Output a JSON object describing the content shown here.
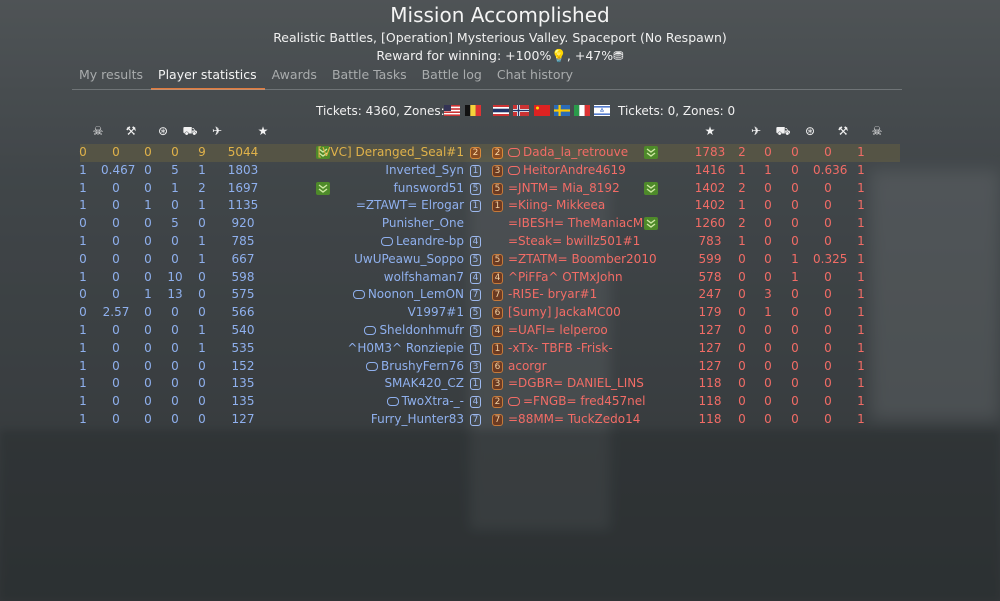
{
  "header": {
    "title": "Mission Accomplished",
    "subtitle": "Realistic Battles, [Operation] Mysterious Valley. Spaceport (No Respawn)",
    "reward": "Reward for winning: +100%💡, +47%⛃"
  },
  "tabs": [
    {
      "label": "My results",
      "active": false
    },
    {
      "label": "Player statistics",
      "active": true
    },
    {
      "label": "Awards",
      "active": false
    },
    {
      "label": "Battle Tasks",
      "active": false
    },
    {
      "label": "Battle log",
      "active": false
    },
    {
      "label": "Chat history",
      "active": false
    }
  ],
  "tickets": {
    "left": "Tickets: 4360, Zones: 0",
    "right": "Tickets: 0, Zones: 0",
    "left_flags": [
      "usa",
      "belgium"
    ],
    "right_flags": [
      "thailand",
      "norway",
      "china",
      "sweden",
      "italy",
      "israel"
    ]
  },
  "column_icons": [
    "deaths-icon",
    "assists-icon",
    "captures-icon",
    "ground-kills-icon",
    "air-kills-icon",
    "score-star-icon"
  ],
  "colors": {
    "ally": "#8fb0ee",
    "enemy": "#f26c66",
    "self": "#e0b24a",
    "accent": "#e07b3e"
  },
  "left_team": [
    {
      "deaths": "0",
      "assists": "0",
      "captures": "0",
      "ground": "0",
      "air": "9",
      "score": "5044",
      "name": "[VVC] Deranged_Seal#1",
      "rank": "2",
      "self": true,
      "chevron": true
    },
    {
      "deaths": "1",
      "assists": "0.467",
      "captures": "0",
      "ground": "5",
      "air": "1",
      "score": "1803",
      "name": "Inverted_Syn",
      "rank": "1"
    },
    {
      "deaths": "1",
      "assists": "0",
      "captures": "0",
      "ground": "1",
      "air": "2",
      "score": "1697",
      "name": "funsword51",
      "rank": "5",
      "chevron": true
    },
    {
      "deaths": "1",
      "assists": "0",
      "captures": "1",
      "ground": "0",
      "air": "1",
      "score": "1135",
      "name": "=ZTAWT= Elrogar",
      "rank": "1"
    },
    {
      "deaths": "0",
      "assists": "0",
      "captures": "0",
      "ground": "5",
      "air": "0",
      "score": "920",
      "name": "Punisher_One",
      "rank": ""
    },
    {
      "deaths": "1",
      "assists": "0",
      "captures": "0",
      "ground": "0",
      "air": "1",
      "score": "785",
      "name": "Leandre-bp",
      "rank": "4",
      "pad": true
    },
    {
      "deaths": "0",
      "assists": "0",
      "captures": "0",
      "ground": "0",
      "air": "1",
      "score": "667",
      "name": "UwUPeawu_Soppo",
      "rank": "5"
    },
    {
      "deaths": "1",
      "assists": "0",
      "captures": "0",
      "ground": "10",
      "air": "0",
      "score": "598",
      "name": "wolfshaman7",
      "rank": "4"
    },
    {
      "deaths": "0",
      "assists": "0",
      "captures": "1",
      "ground": "13",
      "air": "0",
      "score": "575",
      "name": "Noonon_LemON",
      "rank": "7",
      "pad": true
    },
    {
      "deaths": "0",
      "assists": "2.57",
      "captures": "0",
      "ground": "0",
      "air": "0",
      "score": "566",
      "name": "V1997#1",
      "rank": "5"
    },
    {
      "deaths": "1",
      "assists": "0",
      "captures": "0",
      "ground": "0",
      "air": "1",
      "score": "540",
      "name": "Sheldonhmufr",
      "rank": "5",
      "pad": true
    },
    {
      "deaths": "1",
      "assists": "0",
      "captures": "0",
      "ground": "0",
      "air": "1",
      "score": "535",
      "name": "^H0M3^ Ronziepie",
      "rank": "1"
    },
    {
      "deaths": "1",
      "assists": "0",
      "captures": "0",
      "ground": "0",
      "air": "0",
      "score": "152",
      "name": "BrushyFern76",
      "rank": "3",
      "pad": true
    },
    {
      "deaths": "1",
      "assists": "0",
      "captures": "0",
      "ground": "0",
      "air": "0",
      "score": "135",
      "name": "SMAK420_CZ",
      "rank": "1"
    },
    {
      "deaths": "1",
      "assists": "0",
      "captures": "0",
      "ground": "0",
      "air": "0",
      "score": "135",
      "name": "TwoXtra-_-",
      "rank": "4",
      "pad": true
    },
    {
      "deaths": "1",
      "assists": "0",
      "captures": "0",
      "ground": "0",
      "air": "0",
      "score": "127",
      "name": "Furry_Hunter83",
      "rank": "7"
    }
  ],
  "right_team": [
    {
      "rank": "2",
      "name": "Dada_la_retrouve",
      "pad": true,
      "chevron": true,
      "score": "1783",
      "air": "2",
      "ground": "0",
      "captures": "0",
      "assists": "0",
      "deaths": "1"
    },
    {
      "rank": "3",
      "name": "HeitorAndre4619",
      "pad": true,
      "score": "1416",
      "air": "1",
      "ground": "1",
      "captures": "0",
      "assists": "0.636",
      "deaths": "1"
    },
    {
      "rank": "5",
      "name": "=JNTM= Mia_8192",
      "chevron": true,
      "score": "1402",
      "air": "2",
      "ground": "0",
      "captures": "0",
      "assists": "0",
      "deaths": "1"
    },
    {
      "rank": "1",
      "name": "=Kiing- Mikkeea",
      "score": "1402",
      "air": "1",
      "ground": "0",
      "captures": "0",
      "assists": "0",
      "deaths": "1"
    },
    {
      "rank": "",
      "name": "=IBESH= TheManiacMan",
      "chevron": true,
      "score": "1260",
      "air": "2",
      "ground": "0",
      "captures": "0",
      "assists": "0",
      "deaths": "1"
    },
    {
      "rank": "",
      "name": "=Steak= bwillz501#1",
      "score": "783",
      "air": "1",
      "ground": "0",
      "captures": "0",
      "assists": "0",
      "deaths": "1"
    },
    {
      "rank": "5",
      "name": "=ZTATM= Boomber2010",
      "score": "599",
      "air": "0",
      "ground": "0",
      "captures": "1",
      "assists": "0.325",
      "deaths": "1"
    },
    {
      "rank": "4",
      "name": "^PiFFa^ OTMxJohn",
      "pad2": true,
      "score": "578",
      "air": "0",
      "ground": "0",
      "captures": "1",
      "assists": "0",
      "deaths": "1"
    },
    {
      "rank": "7",
      "name": "-RI5E- bryar#1",
      "score": "247",
      "air": "0",
      "ground": "3",
      "captures": "0",
      "assists": "0",
      "deaths": "1"
    },
    {
      "rank": "6",
      "name": "[Sumy] JackaMC00",
      "score": "179",
      "air": "0",
      "ground": "1",
      "captures": "0",
      "assists": "0",
      "deaths": "1"
    },
    {
      "rank": "4",
      "name": "=UAFI= lelperoo",
      "score": "127",
      "air": "0",
      "ground": "0",
      "captures": "0",
      "assists": "0",
      "deaths": "1"
    },
    {
      "rank": "1",
      "name": "-xTx- TBFB -Frisk-",
      "score": "127",
      "air": "0",
      "ground": "0",
      "captures": "0",
      "assists": "0",
      "deaths": "1"
    },
    {
      "rank": "6",
      "name": "acorgr",
      "score": "127",
      "air": "0",
      "ground": "0",
      "captures": "0",
      "assists": "0",
      "deaths": "1"
    },
    {
      "rank": "3",
      "name": "=DGBR= DANIEL_LINS",
      "score": "118",
      "air": "0",
      "ground": "0",
      "captures": "0",
      "assists": "0",
      "deaths": "1"
    },
    {
      "rank": "2",
      "name": "=FNGB= fred457nel",
      "pad": true,
      "score": "118",
      "air": "0",
      "ground": "0",
      "captures": "0",
      "assists": "0",
      "deaths": "1"
    },
    {
      "rank": "7",
      "name": "=88MM= TuckZedo14",
      "score": "118",
      "air": "0",
      "ground": "0",
      "captures": "0",
      "assists": "0",
      "deaths": "1"
    }
  ]
}
